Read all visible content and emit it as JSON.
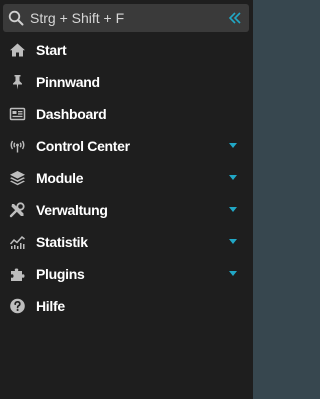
{
  "search": {
    "placeholder": "Strg + Shift + F",
    "collapse_icon": "double-chevron-left-icon"
  },
  "colors": {
    "sidebar_bg": "#1e1e1e",
    "content_bg": "#37474f",
    "search_bg": "#3a3a3a",
    "accent": "#21a7c5",
    "icon": "#bdbdbd",
    "text": "#ffffff"
  },
  "nav": {
    "items": [
      {
        "label": "Start",
        "icon": "home-icon",
        "expandable": false
      },
      {
        "label": "Pinnwand",
        "icon": "pushpin-icon",
        "expandable": false
      },
      {
        "label": "Dashboard",
        "icon": "dashboard-icon",
        "expandable": false
      },
      {
        "label": "Control Center",
        "icon": "broadcast-icon",
        "expandable": true
      },
      {
        "label": "Module",
        "icon": "layers-icon",
        "expandable": true
      },
      {
        "label": "Verwaltung",
        "icon": "tools-icon",
        "expandable": true
      },
      {
        "label": "Statistik",
        "icon": "chart-icon",
        "expandable": true
      },
      {
        "label": "Plugins",
        "icon": "puzzle-icon",
        "expandable": true
      },
      {
        "label": "Hilfe",
        "icon": "help-icon",
        "expandable": false
      }
    ]
  }
}
